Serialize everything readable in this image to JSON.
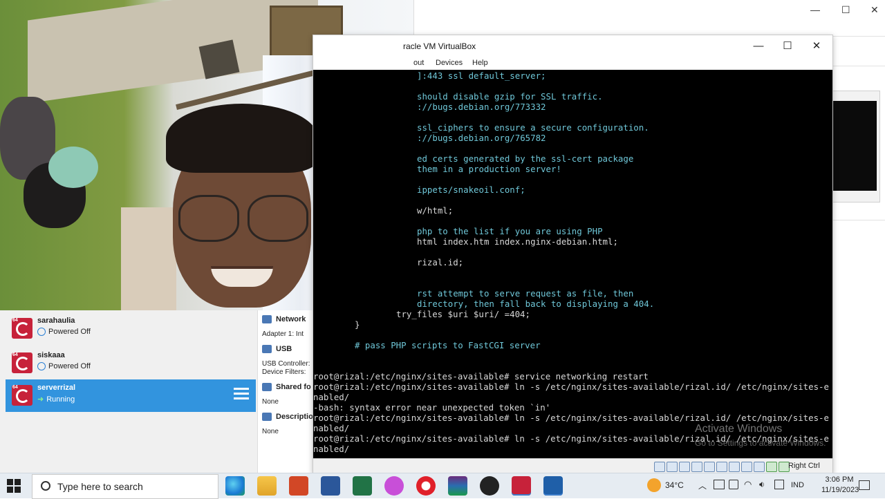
{
  "background_window": {
    "controls": [
      "—",
      "☐",
      "✕"
    ]
  },
  "vm_list": [
    {
      "name": "sarahaulia",
      "status": "Powered Off",
      "selected": false
    },
    {
      "name": "siskaaa",
      "status": "Powered Off",
      "selected": false
    },
    {
      "name": "serverrizal",
      "status": "Running",
      "selected": true
    }
  ],
  "details": {
    "network_header": "Network",
    "network_adapter": "Adapter 1:   Int",
    "usb_header": "USB",
    "usb_controller": "USB Controller:",
    "usb_filters": "Device Filters:",
    "shared_header": "Shared fo",
    "shared_value": "None",
    "description_header": "Descriptio",
    "description_value": "None"
  },
  "vm_window": {
    "title": "racle VM VirtualBox",
    "menu": [
      "out",
      "Devices",
      "Help"
    ],
    "controls": [
      "—",
      "☐",
      "✕"
    ],
    "host_key": "Right Ctrl",
    "watermark_title": "Activate Windows",
    "watermark_sub": "Go to Settings to activate Windows."
  },
  "terminal_lines": [
    {
      "text": "]:443 ssl default_server;",
      "color": "cyan"
    },
    {
      "text": "should disable gzip for SSL traffic.",
      "color": "cyan"
    },
    {
      "text": "://bugs.debian.org/773332",
      "color": "cyan"
    },
    {
      "text": "ssl_ciphers to ensure a secure configuration.",
      "color": "cyan"
    },
    {
      "text": "://bugs.debian.org/765782",
      "color": "cyan"
    },
    {
      "text": "ed certs generated by the ssl-cert package",
      "color": "cyan"
    },
    {
      "text": "them in a production server!",
      "color": "cyan"
    },
    {
      "text": "ippets/snakeoil.conf;",
      "color": "cyan"
    },
    {
      "text": "w/html;",
      "color": "white"
    },
    {
      "text": "php to the list if you are using PHP",
      "color": "cyan"
    },
    {
      "text": "html index.htm index.nginx-debian.html;",
      "color": "white"
    },
    {
      "text": "rizal.id;",
      "color": "white"
    },
    {
      "text": "rst attempt to serve request as file, then",
      "color": "cyan"
    },
    {
      "text": "directory, then fall back to displaying a 404.",
      "color": "cyan"
    },
    {
      "text": "try_files $uri $uri/ =404;",
      "color": "white"
    },
    {
      "text": "}",
      "color": "white"
    },
    {
      "text": "# pass PHP scripts to FastCGI server",
      "color": "cyan"
    },
    {
      "text": "root@rizal:/etc/nginx/sites-available# service networking restart",
      "color": "white"
    },
    {
      "text": "root@rizal:/etc/nginx/sites-available# ln -s /etc/nginx/sites-available/rizal.id/ /etc/nginx/sites-e",
      "color": "white"
    },
    {
      "text": "nabled/",
      "color": "white"
    },
    {
      "text": "-bash: syntax error near unexpected token `in'",
      "color": "white"
    },
    {
      "text": "root@rizal:/etc/nginx/sites-available# ln -s /etc/nginx/sites-available/rizal.id/ /etc/nginx/sites-e",
      "color": "white"
    },
    {
      "text": "nabled/",
      "color": "white"
    },
    {
      "text": "root@rizal:/etc/nginx/sites-available# ln -s /etc/nginx/sites-available/rizal.id/ /etc/nginx/sites-e",
      "color": "white"
    },
    {
      "text": "nabled/",
      "color": "white"
    }
  ],
  "taskbar": {
    "search_placeholder": "Type here to search",
    "apps": [
      "edge-icon",
      "file-explorer-icon",
      "powerpoint-icon",
      "word-icon",
      "excel-icon",
      "wps-icon",
      "opera-icon",
      "winrar-icon",
      "obs-icon",
      "virtualbox-vm-icon",
      "virtualbox-icon"
    ],
    "temperature": "34°C",
    "language": "IND",
    "time": "3:06 PM",
    "date": "11/19/2023"
  },
  "colors": {
    "selection": "#3294de",
    "terminal_bg": "#000000",
    "terminal_cyan": "#6fc7d8",
    "terminal_white": "#d8d8d8"
  }
}
